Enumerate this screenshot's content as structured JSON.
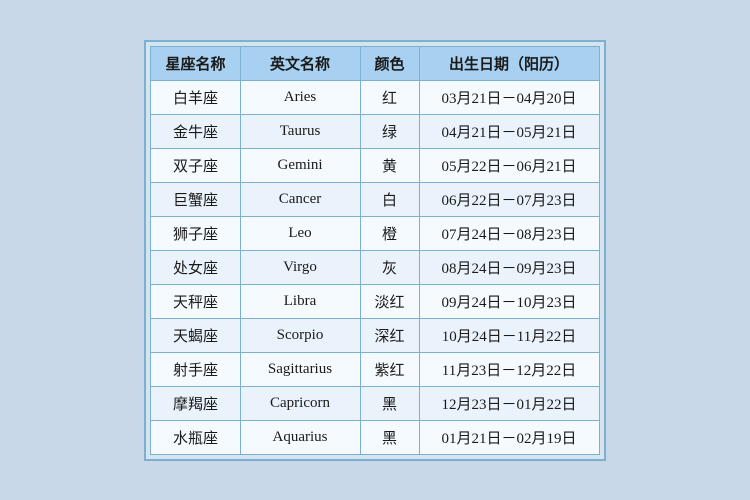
{
  "table": {
    "headers": [
      "星座名称",
      "英文名称",
      "颜色",
      "出生日期（阳历）"
    ],
    "rows": [
      {
        "zh": "白羊座",
        "en": "Aries",
        "color": "红",
        "date": "03月21日－04月20日"
      },
      {
        "zh": "金牛座",
        "en": "Taurus",
        "color": "绿",
        "date": "04月21日－05月21日"
      },
      {
        "zh": "双子座",
        "en": "Gemini",
        "color": "黄",
        "date": "05月22日－06月21日"
      },
      {
        "zh": "巨蟹座",
        "en": "Cancer",
        "color": "白",
        "date": "06月22日－07月23日"
      },
      {
        "zh": "狮子座",
        "en": "Leo",
        "color": "橙",
        "date": "07月24日－08月23日"
      },
      {
        "zh": "处女座",
        "en": "Virgo",
        "color": "灰",
        "date": "08月24日－09月23日"
      },
      {
        "zh": "天秤座",
        "en": "Libra",
        "color": "淡红",
        "date": "09月24日－10月23日"
      },
      {
        "zh": "天蝎座",
        "en": "Scorpio",
        "color": "深红",
        "date": "10月24日－11月22日"
      },
      {
        "zh": "射手座",
        "en": "Sagittarius",
        "color": "紫红",
        "date": "11月23日－12月22日"
      },
      {
        "zh": "摩羯座",
        "en": "Capricorn",
        "color": "黑",
        "date": "12月23日－01月22日"
      },
      {
        "zh": "水瓶座",
        "en": "Aquarius",
        "color": "黑",
        "date": "01月21日－02月19日"
      }
    ]
  }
}
